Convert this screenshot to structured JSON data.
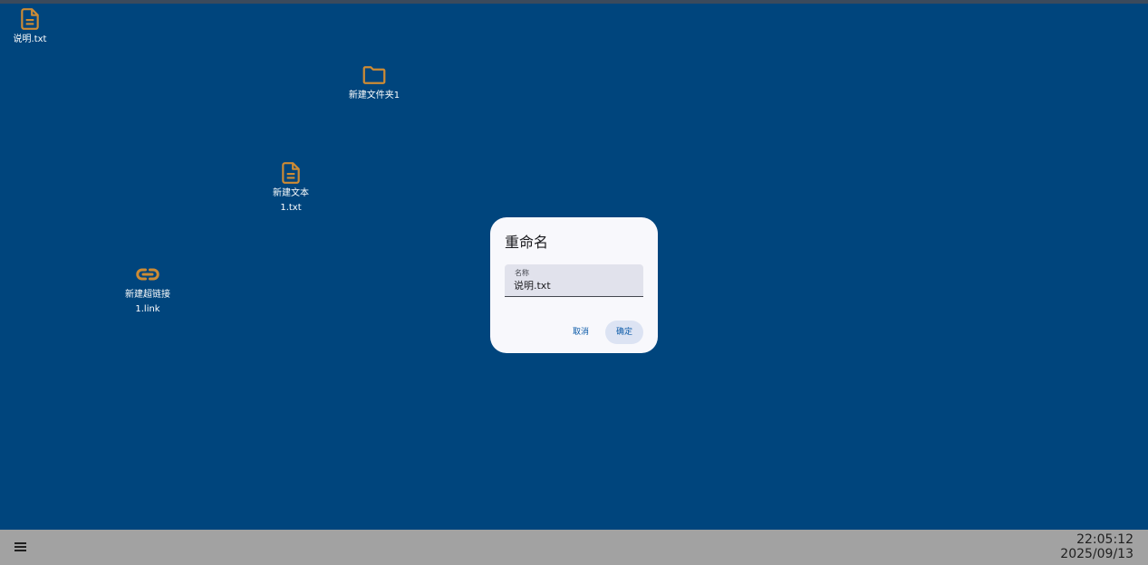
{
  "desktop": {
    "icons": [
      {
        "label": "说明.txt",
        "icon": "file-text-icon"
      },
      {
        "label": "新建文件夹1",
        "icon": "folder-icon"
      },
      {
        "label": "新建文本\n1.txt",
        "icon": "file-text-icon"
      },
      {
        "label": "新建超链接\n1.link",
        "icon": "link-icon"
      }
    ],
    "icon_color": "#cd8b34",
    "background_color": "#00457d"
  },
  "dialog": {
    "title": "重命名",
    "field_label": "名称",
    "field_value": "说明.txt",
    "cancel_label": "取消",
    "ok_label": "确定"
  },
  "taskbar": {
    "menu_icon": "menu-icon",
    "time": "22:05:12",
    "date": "2025/09/13",
    "background_color": "#a2a2a2"
  }
}
